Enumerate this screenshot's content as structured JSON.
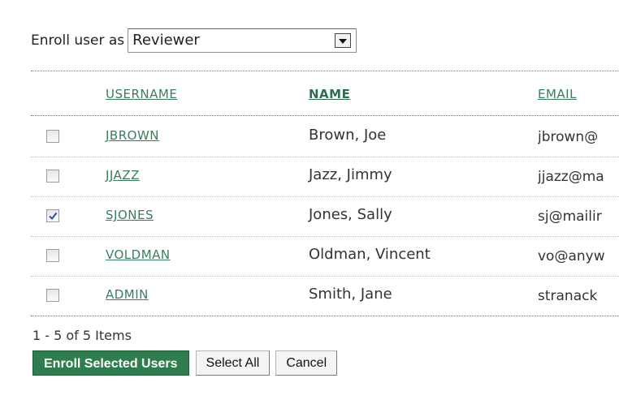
{
  "enroll": {
    "label": "Enroll user as",
    "selected_role": "Reviewer"
  },
  "table": {
    "headers": {
      "username": "USERNAME",
      "name": "NAME",
      "email": "EMAIL"
    },
    "rows": [
      {
        "username": "JBROWN",
        "name": "Brown, Joe",
        "email": "jbrown@",
        "checked": false
      },
      {
        "username": "JJAZZ",
        "name": "Jazz, Jimmy",
        "email": "jjazz@ma",
        "checked": false
      },
      {
        "username": "SJONES",
        "name": "Jones, Sally",
        "email": "sj@mailir",
        "checked": true
      },
      {
        "username": "VOLDMAN",
        "name": "Oldman, Vincent",
        "email": "vo@anyw",
        "checked": false
      },
      {
        "username": "ADMIN",
        "name": "Smith, Jane",
        "email": "stranack",
        "checked": false
      }
    ]
  },
  "footer": {
    "count_text": "1 - 5 of 5 Items",
    "enroll_button": "Enroll Selected Users",
    "select_all_button": "Select All",
    "cancel_button": "Cancel"
  },
  "colors": {
    "link_green": "#3a7d5d",
    "button_green": "#2e7d4f",
    "check_blue": "#2a4fa8"
  }
}
